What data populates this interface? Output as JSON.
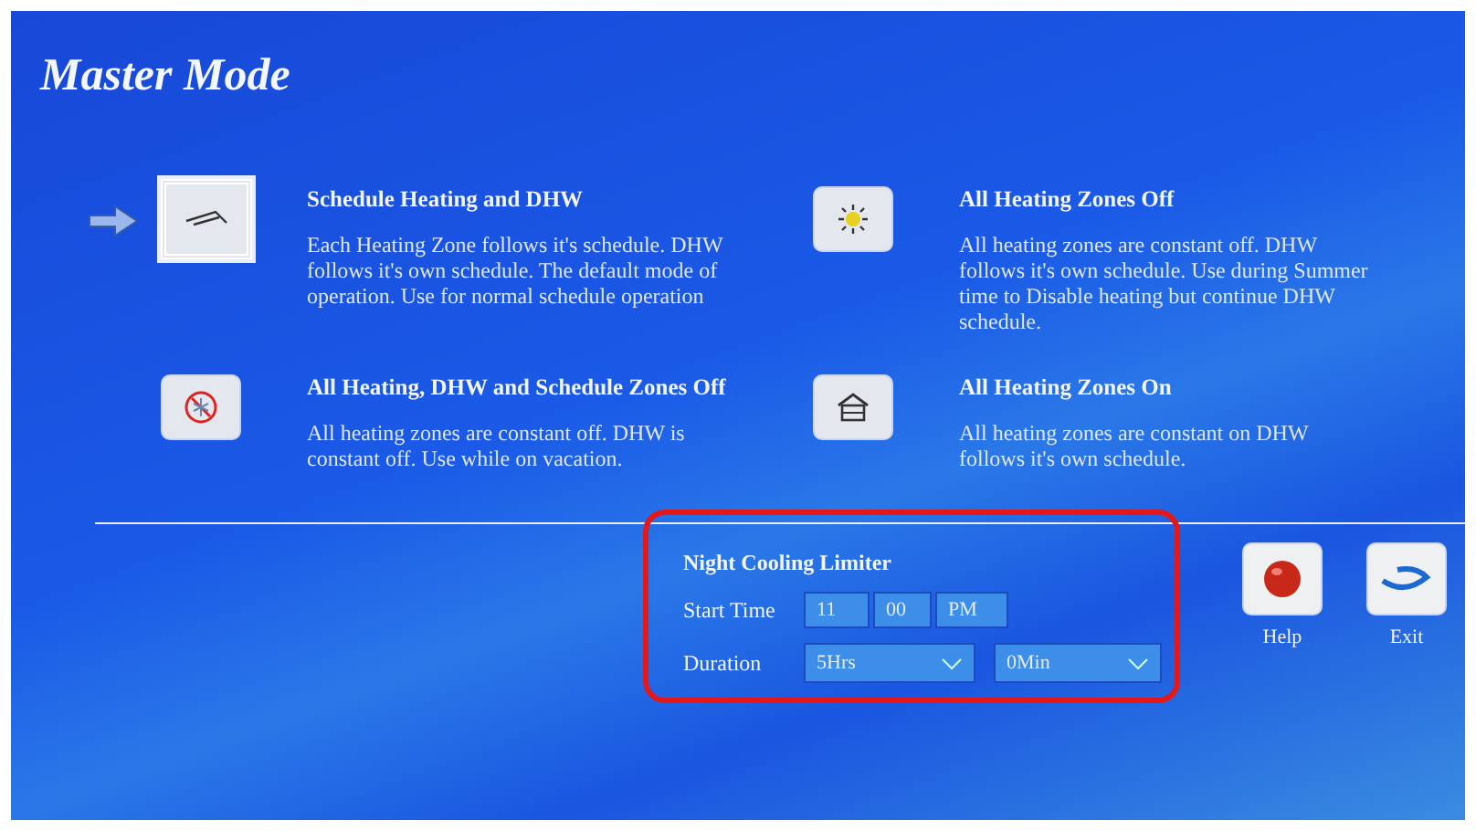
{
  "title": "Master Mode",
  "modes": [
    {
      "kind": "schedule",
      "title": "Schedule Heating and DHW",
      "description": "Each Heating Zone follows it's schedule. DHW follows it's own schedule. The default mode of operation. Use for normal schedule operation",
      "selected": true
    },
    {
      "kind": "sun",
      "title": "All Heating Zones Off",
      "description": "All heating zones are constant off. DHW follows it's own schedule. Use during Summer time to Disable heating but continue DHW schedule.",
      "selected": false
    },
    {
      "kind": "off",
      "title": "All Heating, DHW and Schedule Zones Off",
      "description": "All heating zones are constant off. DHW is constant off. Use while on vacation.",
      "selected": false
    },
    {
      "kind": "house",
      "title": "All Heating Zones On",
      "description": "All heating zones are constant on DHW follows it's own schedule.",
      "selected": false
    }
  ],
  "night_cooling": {
    "title": "Night Cooling Limiter",
    "highlighted": true,
    "start_time": {
      "label": "Start Time",
      "hour": "11",
      "minute": "00",
      "period": "PM"
    },
    "duration": {
      "label": "Duration",
      "hours": "5Hrs",
      "minutes": "0Min"
    }
  },
  "buttons": [
    {
      "kind": "help",
      "label": "Help"
    },
    {
      "kind": "exit",
      "label": "Exit"
    }
  ]
}
